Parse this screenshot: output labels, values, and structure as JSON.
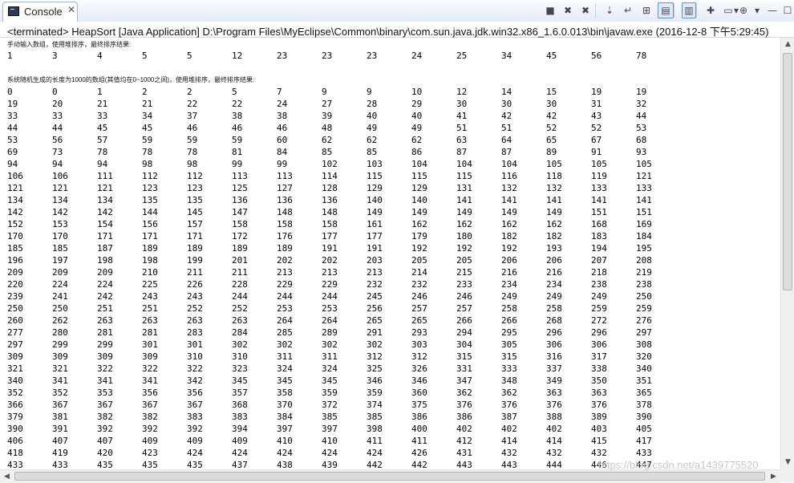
{
  "tab": {
    "title": "Console",
    "close": "✕"
  },
  "toolbar": [
    {
      "name": "terminate-icon",
      "glyph": "■"
    },
    {
      "name": "remove-launch-icon",
      "glyph": "✖"
    },
    {
      "name": "remove-all-terminated-icon",
      "glyph": "✖"
    },
    {
      "name": "scroll-lock-icon",
      "glyph": "⇣"
    },
    {
      "name": "word-wrap-icon",
      "glyph": "↵"
    },
    {
      "name": "pin-console-icon",
      "glyph": "⊞"
    },
    {
      "name": "show-on-stdout-icon",
      "glyph": "▤"
    },
    {
      "name": "show-on-stderr-icon",
      "glyph": "▥"
    },
    {
      "name": "new-console-icon",
      "glyph": "✚"
    },
    {
      "name": "display-console-icon",
      "glyph": "▭"
    },
    {
      "name": "display-console-dropdown-icon",
      "glyph": "▾"
    },
    {
      "name": "open-console-icon",
      "glyph": "⊕"
    },
    {
      "name": "open-console-dropdown-icon",
      "glyph": "▾"
    },
    {
      "name": "minimize-icon",
      "glyph": "—"
    },
    {
      "name": "maximize-icon",
      "glyph": "☐"
    }
  ],
  "status": "<terminated> HeapSort [Java Application] D:\\Program Files\\MyEclipse\\Common\\binary\\com.sun.java.jdk.win32.x86_1.6.0.013\\bin\\javaw.exe (2016-12-8 下午5:29:45)",
  "console": {
    "note1": "手动输入数组，使用堆排序，最终排序结果:",
    "manual": [
      "1",
      "3",
      "4",
      "5",
      "5",
      "12",
      "23",
      "23",
      "23",
      "24",
      "25",
      "34",
      "45",
      "56",
      "78"
    ],
    "note2": "系统随机生成的长度为1000的数组(其值均在0~1000之间)，使用堆排序，最终排序结果:",
    "rows": [
      [
        "0",
        "0",
        "1",
        "2",
        "2",
        "5",
        "7",
        "9",
        "9",
        "10",
        "12",
        "14",
        "15",
        "19",
        "19"
      ],
      [
        "19",
        "20",
        "21",
        "21",
        "22",
        "22",
        "24",
        "27",
        "28",
        "29",
        "30",
        "30",
        "30",
        "31",
        "32"
      ],
      [
        "33",
        "33",
        "33",
        "34",
        "37",
        "38",
        "38",
        "39",
        "40",
        "40",
        "41",
        "42",
        "42",
        "43",
        "44"
      ],
      [
        "44",
        "44",
        "45",
        "45",
        "46",
        "46",
        "46",
        "48",
        "49",
        "49",
        "51",
        "51",
        "52",
        "52",
        "53"
      ],
      [
        "53",
        "56",
        "57",
        "59",
        "59",
        "59",
        "60",
        "62",
        "62",
        "62",
        "63",
        "64",
        "65",
        "67",
        "68"
      ],
      [
        "69",
        "73",
        "78",
        "78",
        "78",
        "81",
        "84",
        "85",
        "85",
        "86",
        "87",
        "87",
        "89",
        "91",
        "93"
      ],
      [
        "94",
        "94",
        "94",
        "98",
        "98",
        "99",
        "99",
        "102",
        "103",
        "104",
        "104",
        "104",
        "105",
        "105",
        "105"
      ],
      [
        "106",
        "106",
        "111",
        "112",
        "112",
        "113",
        "113",
        "114",
        "115",
        "115",
        "115",
        "116",
        "118",
        "119",
        "121"
      ],
      [
        "121",
        "121",
        "121",
        "123",
        "123",
        "125",
        "127",
        "128",
        "129",
        "129",
        "131",
        "132",
        "132",
        "133",
        "133"
      ],
      [
        "134",
        "134",
        "134",
        "135",
        "135",
        "136",
        "136",
        "136",
        "140",
        "140",
        "141",
        "141",
        "141",
        "141",
        "141"
      ],
      [
        "142",
        "142",
        "142",
        "144",
        "145",
        "147",
        "148",
        "148",
        "149",
        "149",
        "149",
        "149",
        "149",
        "151",
        "151"
      ],
      [
        "152",
        "153",
        "154",
        "156",
        "157",
        "158",
        "158",
        "158",
        "161",
        "162",
        "162",
        "162",
        "162",
        "168",
        "169"
      ],
      [
        "170",
        "170",
        "171",
        "171",
        "171",
        "172",
        "176",
        "177",
        "177",
        "179",
        "180",
        "182",
        "182",
        "183",
        "184"
      ],
      [
        "185",
        "185",
        "187",
        "189",
        "189",
        "189",
        "189",
        "191",
        "191",
        "192",
        "192",
        "192",
        "193",
        "194",
        "195"
      ],
      [
        "196",
        "197",
        "198",
        "198",
        "199",
        "201",
        "202",
        "202",
        "203",
        "205",
        "205",
        "206",
        "206",
        "207",
        "208"
      ],
      [
        "209",
        "209",
        "209",
        "210",
        "211",
        "211",
        "213",
        "213",
        "213",
        "214",
        "215",
        "216",
        "216",
        "218",
        "219"
      ],
      [
        "220",
        "224",
        "224",
        "225",
        "226",
        "228",
        "229",
        "229",
        "232",
        "232",
        "233",
        "234",
        "234",
        "238",
        "238"
      ],
      [
        "239",
        "241",
        "242",
        "243",
        "243",
        "244",
        "244",
        "244",
        "245",
        "246",
        "246",
        "249",
        "249",
        "249",
        "250"
      ],
      [
        "250",
        "250",
        "251",
        "251",
        "252",
        "252",
        "253",
        "253",
        "256",
        "257",
        "257",
        "258",
        "258",
        "259",
        "259"
      ],
      [
        "260",
        "262",
        "263",
        "263",
        "263",
        "263",
        "264",
        "264",
        "265",
        "265",
        "266",
        "266",
        "268",
        "272",
        "276"
      ],
      [
        "277",
        "280",
        "281",
        "281",
        "283",
        "284",
        "285",
        "289",
        "291",
        "293",
        "294",
        "295",
        "296",
        "296",
        "297"
      ],
      [
        "297",
        "299",
        "299",
        "301",
        "301",
        "302",
        "302",
        "302",
        "302",
        "303",
        "304",
        "305",
        "306",
        "306",
        "308"
      ],
      [
        "309",
        "309",
        "309",
        "309",
        "310",
        "310",
        "311",
        "311",
        "312",
        "312",
        "315",
        "315",
        "316",
        "317",
        "320"
      ],
      [
        "321",
        "321",
        "322",
        "322",
        "322",
        "323",
        "324",
        "324",
        "325",
        "326",
        "331",
        "333",
        "337",
        "338",
        "340"
      ],
      [
        "340",
        "341",
        "341",
        "341",
        "342",
        "345",
        "345",
        "345",
        "346",
        "346",
        "347",
        "348",
        "349",
        "350",
        "351"
      ],
      [
        "352",
        "352",
        "353",
        "356",
        "356",
        "357",
        "358",
        "359",
        "359",
        "360",
        "362",
        "362",
        "363",
        "363",
        "365"
      ],
      [
        "366",
        "367",
        "367",
        "367",
        "367",
        "368",
        "370",
        "372",
        "374",
        "375",
        "376",
        "376",
        "376",
        "376",
        "378"
      ],
      [
        "379",
        "381",
        "382",
        "382",
        "383",
        "383",
        "384",
        "385",
        "385",
        "386",
        "386",
        "387",
        "388",
        "389",
        "390"
      ],
      [
        "390",
        "391",
        "392",
        "392",
        "392",
        "394",
        "397",
        "397",
        "398",
        "400",
        "402",
        "402",
        "402",
        "403",
        "405"
      ],
      [
        "406",
        "407",
        "407",
        "409",
        "409",
        "409",
        "410",
        "410",
        "411",
        "411",
        "412",
        "414",
        "414",
        "415",
        "417"
      ],
      [
        "418",
        "419",
        "420",
        "423",
        "424",
        "424",
        "424",
        "424",
        "424",
        "426",
        "431",
        "432",
        "432",
        "432",
        "433"
      ],
      [
        "433",
        "433",
        "435",
        "435",
        "435",
        "437",
        "438",
        "439",
        "442",
        "442",
        "443",
        "443",
        "444",
        "446",
        "447"
      ]
    ]
  },
  "watermark": "https://blog.csdn.net/a1439775520"
}
